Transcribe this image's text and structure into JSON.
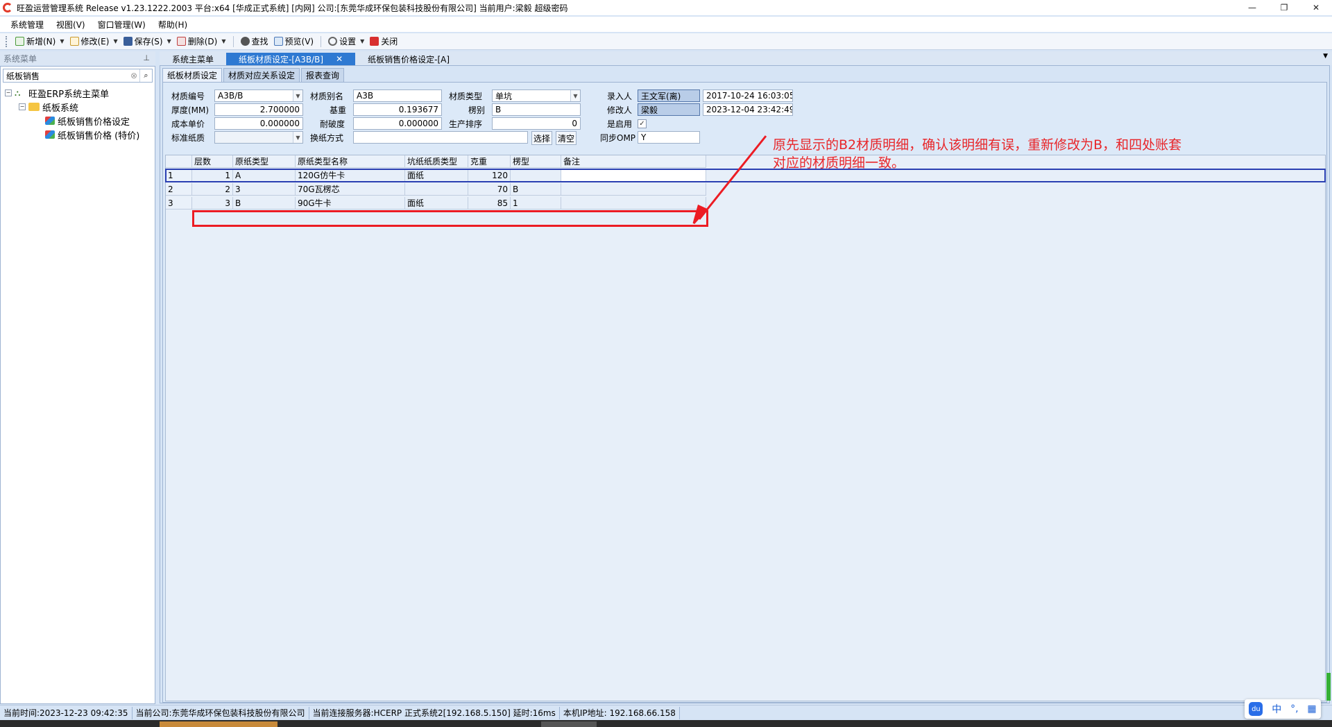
{
  "window": {
    "title": "旺盈运营管理系统 Release v1.23.1222.2003 平台:x64  [华成正式系统] [内网] 公司:[东莞华成环保包装科技股份有限公司] 当前用户:梁毅  超级密码",
    "controls": [
      "—",
      "❐",
      "✕"
    ]
  },
  "menu": [
    "系统管理",
    "视图(V)",
    "窗口管理(W)",
    "帮助(H)"
  ],
  "toolbar": {
    "new": "新增(N)",
    "edit": "修改(E)",
    "save": "保存(S)",
    "delete": "删除(D)",
    "find": "查找",
    "preview": "预览(V)",
    "settings": "设置",
    "close": "关闭"
  },
  "sidebar": {
    "header": "系统菜单",
    "search_value": "纸板销售",
    "tree": {
      "root": "旺盈ERP系统主菜单",
      "folder": "纸板系统",
      "leaves": [
        "纸板销售价格设定",
        "纸板销售价格 (特价)"
      ]
    }
  },
  "doc_tabs": [
    "系统主菜单",
    "纸板材质设定-[A3B/B]",
    "纸板销售价格设定-[A]"
  ],
  "sub_tabs": [
    "纸板材质设定",
    "材质对应关系设定",
    "报表查询"
  ],
  "form": {
    "code_label": "材质编号",
    "code": "A3B/B",
    "alias_label": "材质别名",
    "alias": "A3B",
    "type_label": "材质类型",
    "type": "单坑",
    "creator_label": "录入人",
    "creator": "王文军(离)",
    "created_at": "2017-10-24 16:03:05",
    "thickness_label": "厚度(MM)",
    "thickness": "2.700000",
    "basis_label": "基重",
    "basis": "0.193677",
    "flute_label": "楞别",
    "flute": "B",
    "modifier_label": "修改人",
    "modifier": "梁毅",
    "modified_at": "2023-12-04 23:42:49",
    "cost_label": "成本单价",
    "cost": "0.000000",
    "burst_label": "耐破度",
    "burst": "0.000000",
    "order_label": "生产排序",
    "order": "0",
    "enabled_label": "是启用",
    "enabled": "✓",
    "std_paper_label": "标准纸质",
    "std_paper": "",
    "change_label": "换纸方式",
    "change": "",
    "select_btn": "选择",
    "clear_btn": "清空",
    "sync_label": "同步OMP",
    "sync": "Y"
  },
  "grid": {
    "columns": [
      "层数",
      "原纸类型",
      "原纸类型名称",
      "坑纸纸质类型",
      "克重",
      "楞型",
      "备注"
    ],
    "rows": [
      {
        "row": "1",
        "layer": "1",
        "type": "A",
        "name": "120G仿牛卡",
        "kind": "面纸",
        "weight": "120",
        "flute": "",
        "note": ""
      },
      {
        "row": "2",
        "layer": "2",
        "type": "3",
        "name": "70G瓦楞芯",
        "kind": "",
        "weight": "70",
        "flute": "B",
        "note": ""
      },
      {
        "row": "3",
        "layer": "3",
        "type": "B",
        "name": "90G牛卡",
        "kind": "面纸",
        "weight": "85",
        "flute": "1",
        "note": ""
      }
    ]
  },
  "annotation": "原先显示的B2材质明细，确认该明细有误，重新修改为B，和四处账套\n对应的材质明细一致。",
  "status": [
    "当前时间:2023-12-23 09:42:35",
    "当前公司:东莞华成环保包装科技股份有限公司",
    "当前连接服务器:HCERP 正式系统2[192.168.5.150] 延时:16ms",
    "本机IP地址: 192.168.66.158"
  ],
  "ime": {
    "lang": "中",
    "punct": "°,"
  },
  "colors": {
    "accent_tab": "#2e79d2",
    "annotation_red": "#e8262a",
    "panel_bg": "#dce9f8"
  }
}
